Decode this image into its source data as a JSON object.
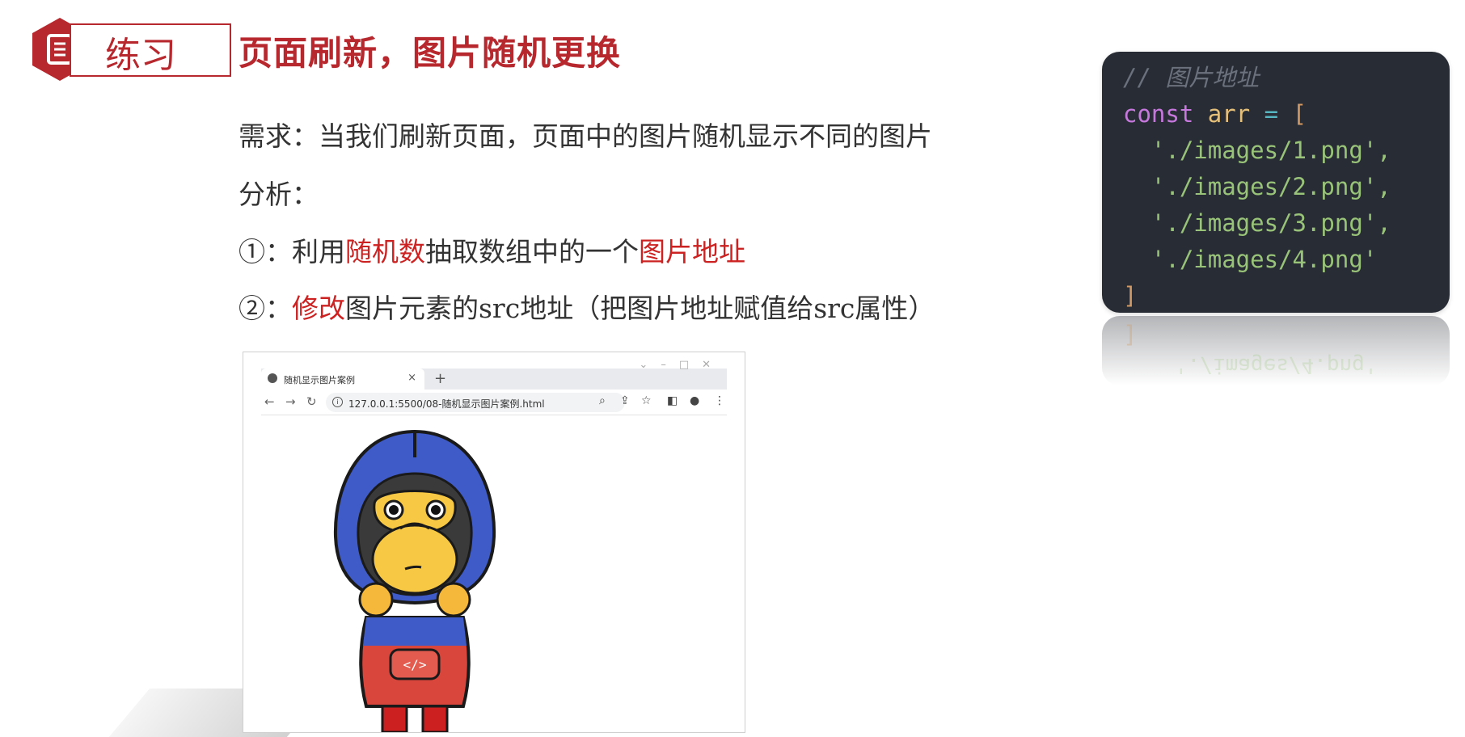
{
  "badge": {
    "label": "练习",
    "icon": "document-icon",
    "color": "#b7282e"
  },
  "title": "页面刷新，图片随机更换",
  "lines": {
    "requirement": "需求：当我们刷新页面，页面中的图片随机显示不同的图片",
    "analysis": "分析：",
    "step1": {
      "prefix": "①：利用",
      "highlight1": "随机数",
      "middle": "抽取数组中的一个",
      "highlight2": "图片地址"
    },
    "step2": {
      "prefix": "②：",
      "highlight": "修改",
      "rest": "图片元素的src地址（把图片地址赋值给src属性）"
    }
  },
  "code": {
    "comment": "// 图片地址",
    "keyword": "const",
    "var": "arr",
    "op": "=",
    "open": "[",
    "items": [
      "'./images/1.png',",
      "'./images/2.png',",
      "'./images/3.png',",
      "'./images/4.png'"
    ],
    "close": "]"
  },
  "browser": {
    "tab_title": "随机显示图片案例",
    "tab_close": "×",
    "new_tab": "+",
    "url": "127.0.0.1:5500/08-随机显示图片案例.html",
    "nav_icons": [
      "back-icon",
      "forward-icon",
      "reload-icon"
    ],
    "tool_icons": [
      "zoom-icon",
      "share-icon",
      "star-icon",
      "sidepanel-icon",
      "profile-icon",
      "menu-icon"
    ]
  },
  "colors": {
    "accent": "#b7282e",
    "highlight": "#cc2222",
    "code_bg": "#282c34"
  }
}
